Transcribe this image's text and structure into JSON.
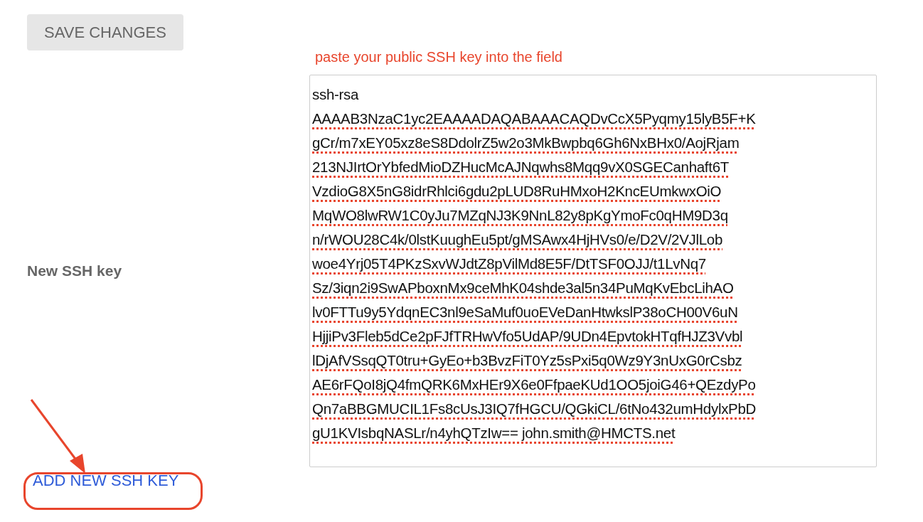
{
  "save_button": {
    "label": "SAVE CHANGES"
  },
  "hint": "paste your public SSH key into the field",
  "ssh_key_field": {
    "label": "New SSH key",
    "value_lines": [
      "ssh-rsa",
      "AAAAB3NzaC1yc2EAAAADAQABAAACAQDvCcX5Pyqmy15lyB5F+K",
      "gCr/m7xEY05xz8eS8DdolrZ5w2o3MkBwpbq6Gh6NxBHx0/AojRjam",
      "213NJIrtOrYbfedMioDZHucMcAJNqwhs8Mqq9vX0SGECanhaft6T",
      "VzdioG8X5nG8idrRhlci6gdu2pLUD8RuHMxoH2KncEUmkwxOiO",
      "MqWO8lwRW1C0yJu7MZqNJ3K9NnL82y8pKgYmoFc0qHM9D3q",
      "n/rWOU28C4k/0lstKuughEu5pt/gMSAwx4HjHVs0/e/D2V/2VJlLob",
      "woe4Yrj05T4PKzSxvWJdtZ8pVilMd8E5F/DtTSF0OJJ/t1LvNq7",
      "Sz/3iqn2i9SwAPboxnMx9ceMhK04shde3al5n34PuMqKvEbcLihAO",
      "lv0FTTu9y5YdqnEC3nl9eSaMuf0uoEVeDanHtwkslP38oCH00V6uN",
      "HjjiPv3Fleb5dCe2pFJfTRHwVfo5UdAP/9UDn4EpvtokHTqfHJZ3Vvbl",
      "lDjAfVSsqQT0tru+GyEo+b3BvzFiT0Yz5sPxi5q0Wz9Y3nUxG0rCsbz",
      "AE6rFQoI8jQ4fmQRK6MxHEr9X6e0FfpaeKUd1OO5joiG46+QEzdyPo",
      "Qn7aBBGMUCIL1Fs8cUsJ3IQ7fHGCU/QGkiCL/6tNo432umHdylxPbD",
      "gU1KVIsbqNASLr/n4yhQTzIw== john.smith@HMCTS.net"
    ]
  },
  "add_link": {
    "label": "ADD NEW SSH KEY"
  }
}
